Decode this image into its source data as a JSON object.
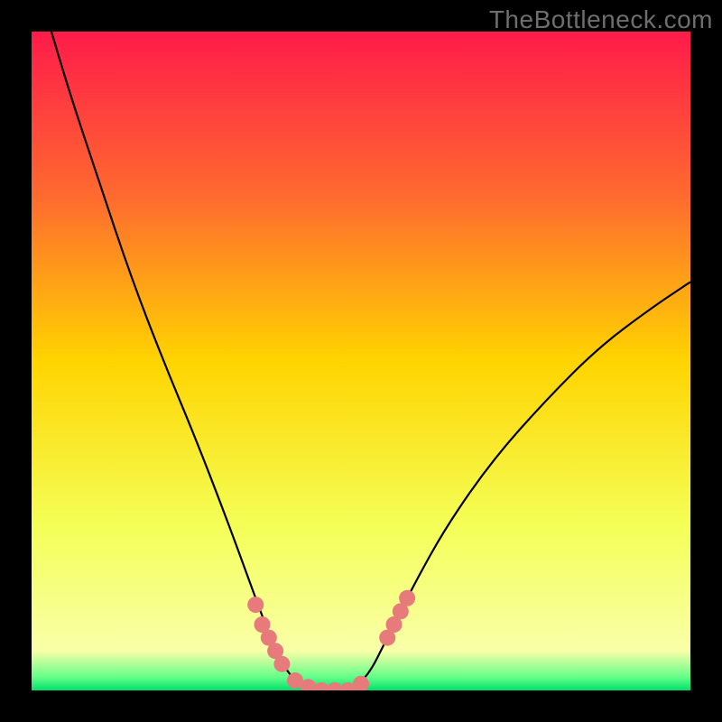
{
  "watermark": "TheBottleneck.com",
  "chart_data": {
    "type": "line",
    "title": "",
    "xlabel": "",
    "ylabel": "",
    "xlim": [
      0,
      100
    ],
    "ylim": [
      0,
      100
    ],
    "grid": false,
    "legend": false,
    "background": {
      "type": "vertical-gradient",
      "note": "gradient fills the plot area from top (y=100) to bottom (y=0); colors keyed by y-value",
      "stops": [
        {
          "y": 100,
          "color": "#ff1b4a"
        },
        {
          "y": 75,
          "color": "#ff6a2f"
        },
        {
          "y": 50,
          "color": "#ffd400"
        },
        {
          "y": 25,
          "color": "#f4ff57"
        },
        {
          "y": 6,
          "color": "#f9ffa8"
        },
        {
          "y": 2,
          "color": "#63ff89"
        },
        {
          "y": 0,
          "color": "#00e06a"
        }
      ]
    },
    "series": [
      {
        "name": "bottleneck-curve",
        "style": "thin-black",
        "points": [
          {
            "x": 3,
            "y": 100
          },
          {
            "x": 6,
            "y": 90
          },
          {
            "x": 10,
            "y": 78
          },
          {
            "x": 15,
            "y": 63
          },
          {
            "x": 20,
            "y": 50
          },
          {
            "x": 25,
            "y": 38
          },
          {
            "x": 30,
            "y": 25
          },
          {
            "x": 34,
            "y": 14
          },
          {
            "x": 37,
            "y": 6
          },
          {
            "x": 40,
            "y": 1
          },
          {
            "x": 44,
            "y": 0
          },
          {
            "x": 48,
            "y": 0
          },
          {
            "x": 51,
            "y": 2
          },
          {
            "x": 54,
            "y": 8
          },
          {
            "x": 58,
            "y": 16
          },
          {
            "x": 63,
            "y": 25
          },
          {
            "x": 70,
            "y": 35
          },
          {
            "x": 78,
            "y": 44
          },
          {
            "x": 86,
            "y": 52
          },
          {
            "x": 94,
            "y": 58
          },
          {
            "x": 100,
            "y": 62
          }
        ]
      },
      {
        "name": "highlight-dots-left",
        "style": "thick-salmon-dots",
        "points": [
          {
            "x": 34,
            "y": 13
          },
          {
            "x": 35,
            "y": 10
          },
          {
            "x": 36,
            "y": 8
          },
          {
            "x": 37,
            "y": 6
          },
          {
            "x": 38,
            "y": 4
          },
          {
            "x": 40,
            "y": 1.5
          },
          {
            "x": 42,
            "y": 0.5
          },
          {
            "x": 44,
            "y": 0
          },
          {
            "x": 46,
            "y": 0
          },
          {
            "x": 48,
            "y": 0
          },
          {
            "x": 50,
            "y": 1
          }
        ]
      },
      {
        "name": "highlight-dots-right",
        "style": "thick-salmon-dots",
        "points": [
          {
            "x": 54,
            "y": 8
          },
          {
            "x": 55,
            "y": 10
          },
          {
            "x": 56,
            "y": 12
          },
          {
            "x": 57,
            "y": 14
          }
        ]
      }
    ],
    "colors": {
      "curve": "#000000",
      "highlight": "#e77a7a"
    }
  }
}
